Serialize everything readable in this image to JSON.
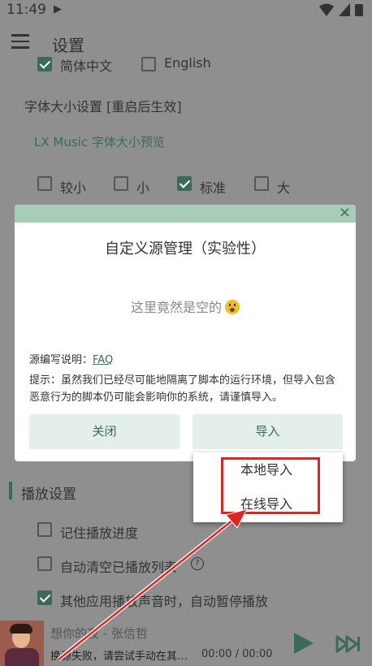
{
  "status_bar": {
    "time": "11:49",
    "play_glyph": "▶"
  },
  "header": {
    "title": "设置"
  },
  "language": {
    "opt_zh": "简体中文",
    "opt_en": "English"
  },
  "font_size": {
    "title": "字体大小设置 [重启后生效]",
    "preview": "LX Music 字体大小预览",
    "options": [
      "较小",
      "小",
      "标准",
      "大"
    ],
    "selected": "标准"
  },
  "dialog": {
    "title": "自定义源管理（实验性）",
    "empty_text": "这里竟然是空的",
    "doc_label": "源编写说明：",
    "doc_link": "FAQ",
    "tip": "提示：虽然我们已经尽可能地隔离了脚本的运行环境，但导入包含恶意行为的脚本仍可能会影响你的系统，请谨慎导入。",
    "close_button": "关闭",
    "import_button": "导入",
    "close_icon": "×"
  },
  "import_menu": {
    "local": "本地导入",
    "online": "在线导入"
  },
  "playback": {
    "section_title": "播放设置",
    "remember_progress": "记住播放进度",
    "auto_clear": "自动清空已播放列表",
    "pause_on_other": "其他应用播放声音时，自动暂停播放"
  },
  "player": {
    "song": "想你的夜 - 张信哲",
    "status": "换源失败，请尝试手动在其…",
    "time": "00:00 / 00:00"
  },
  "colors": {
    "accent": "#3a6b57",
    "highlight_box": "#e02424",
    "dim_bg": "#8f8f8f"
  }
}
